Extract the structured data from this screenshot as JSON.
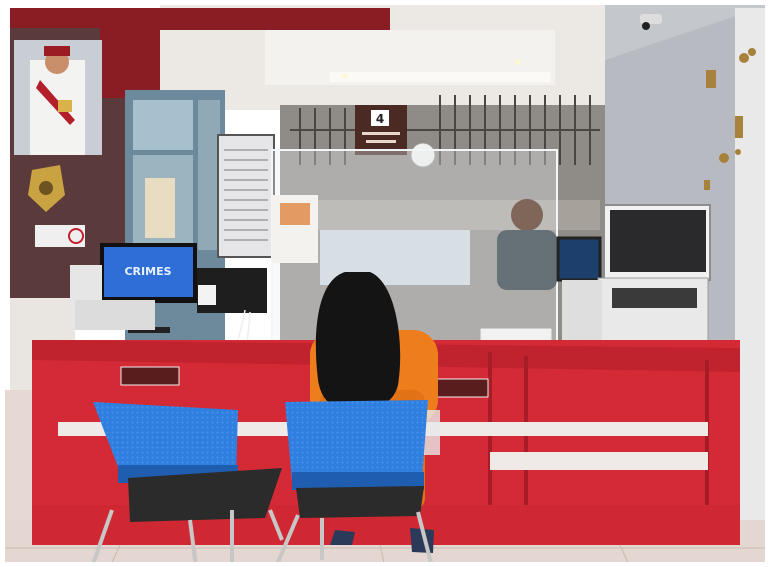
{
  "photo": {
    "counter_number": "4",
    "monitor_screen_text": "CRIMES"
  },
  "palette": {
    "counter_red": "#d42a35",
    "chair_blue": "#2f7fe0",
    "shirt_orange": "#ee7d1c",
    "wall_grey": "#c9ccd0",
    "ceiling_white": "#ece9e4"
  }
}
